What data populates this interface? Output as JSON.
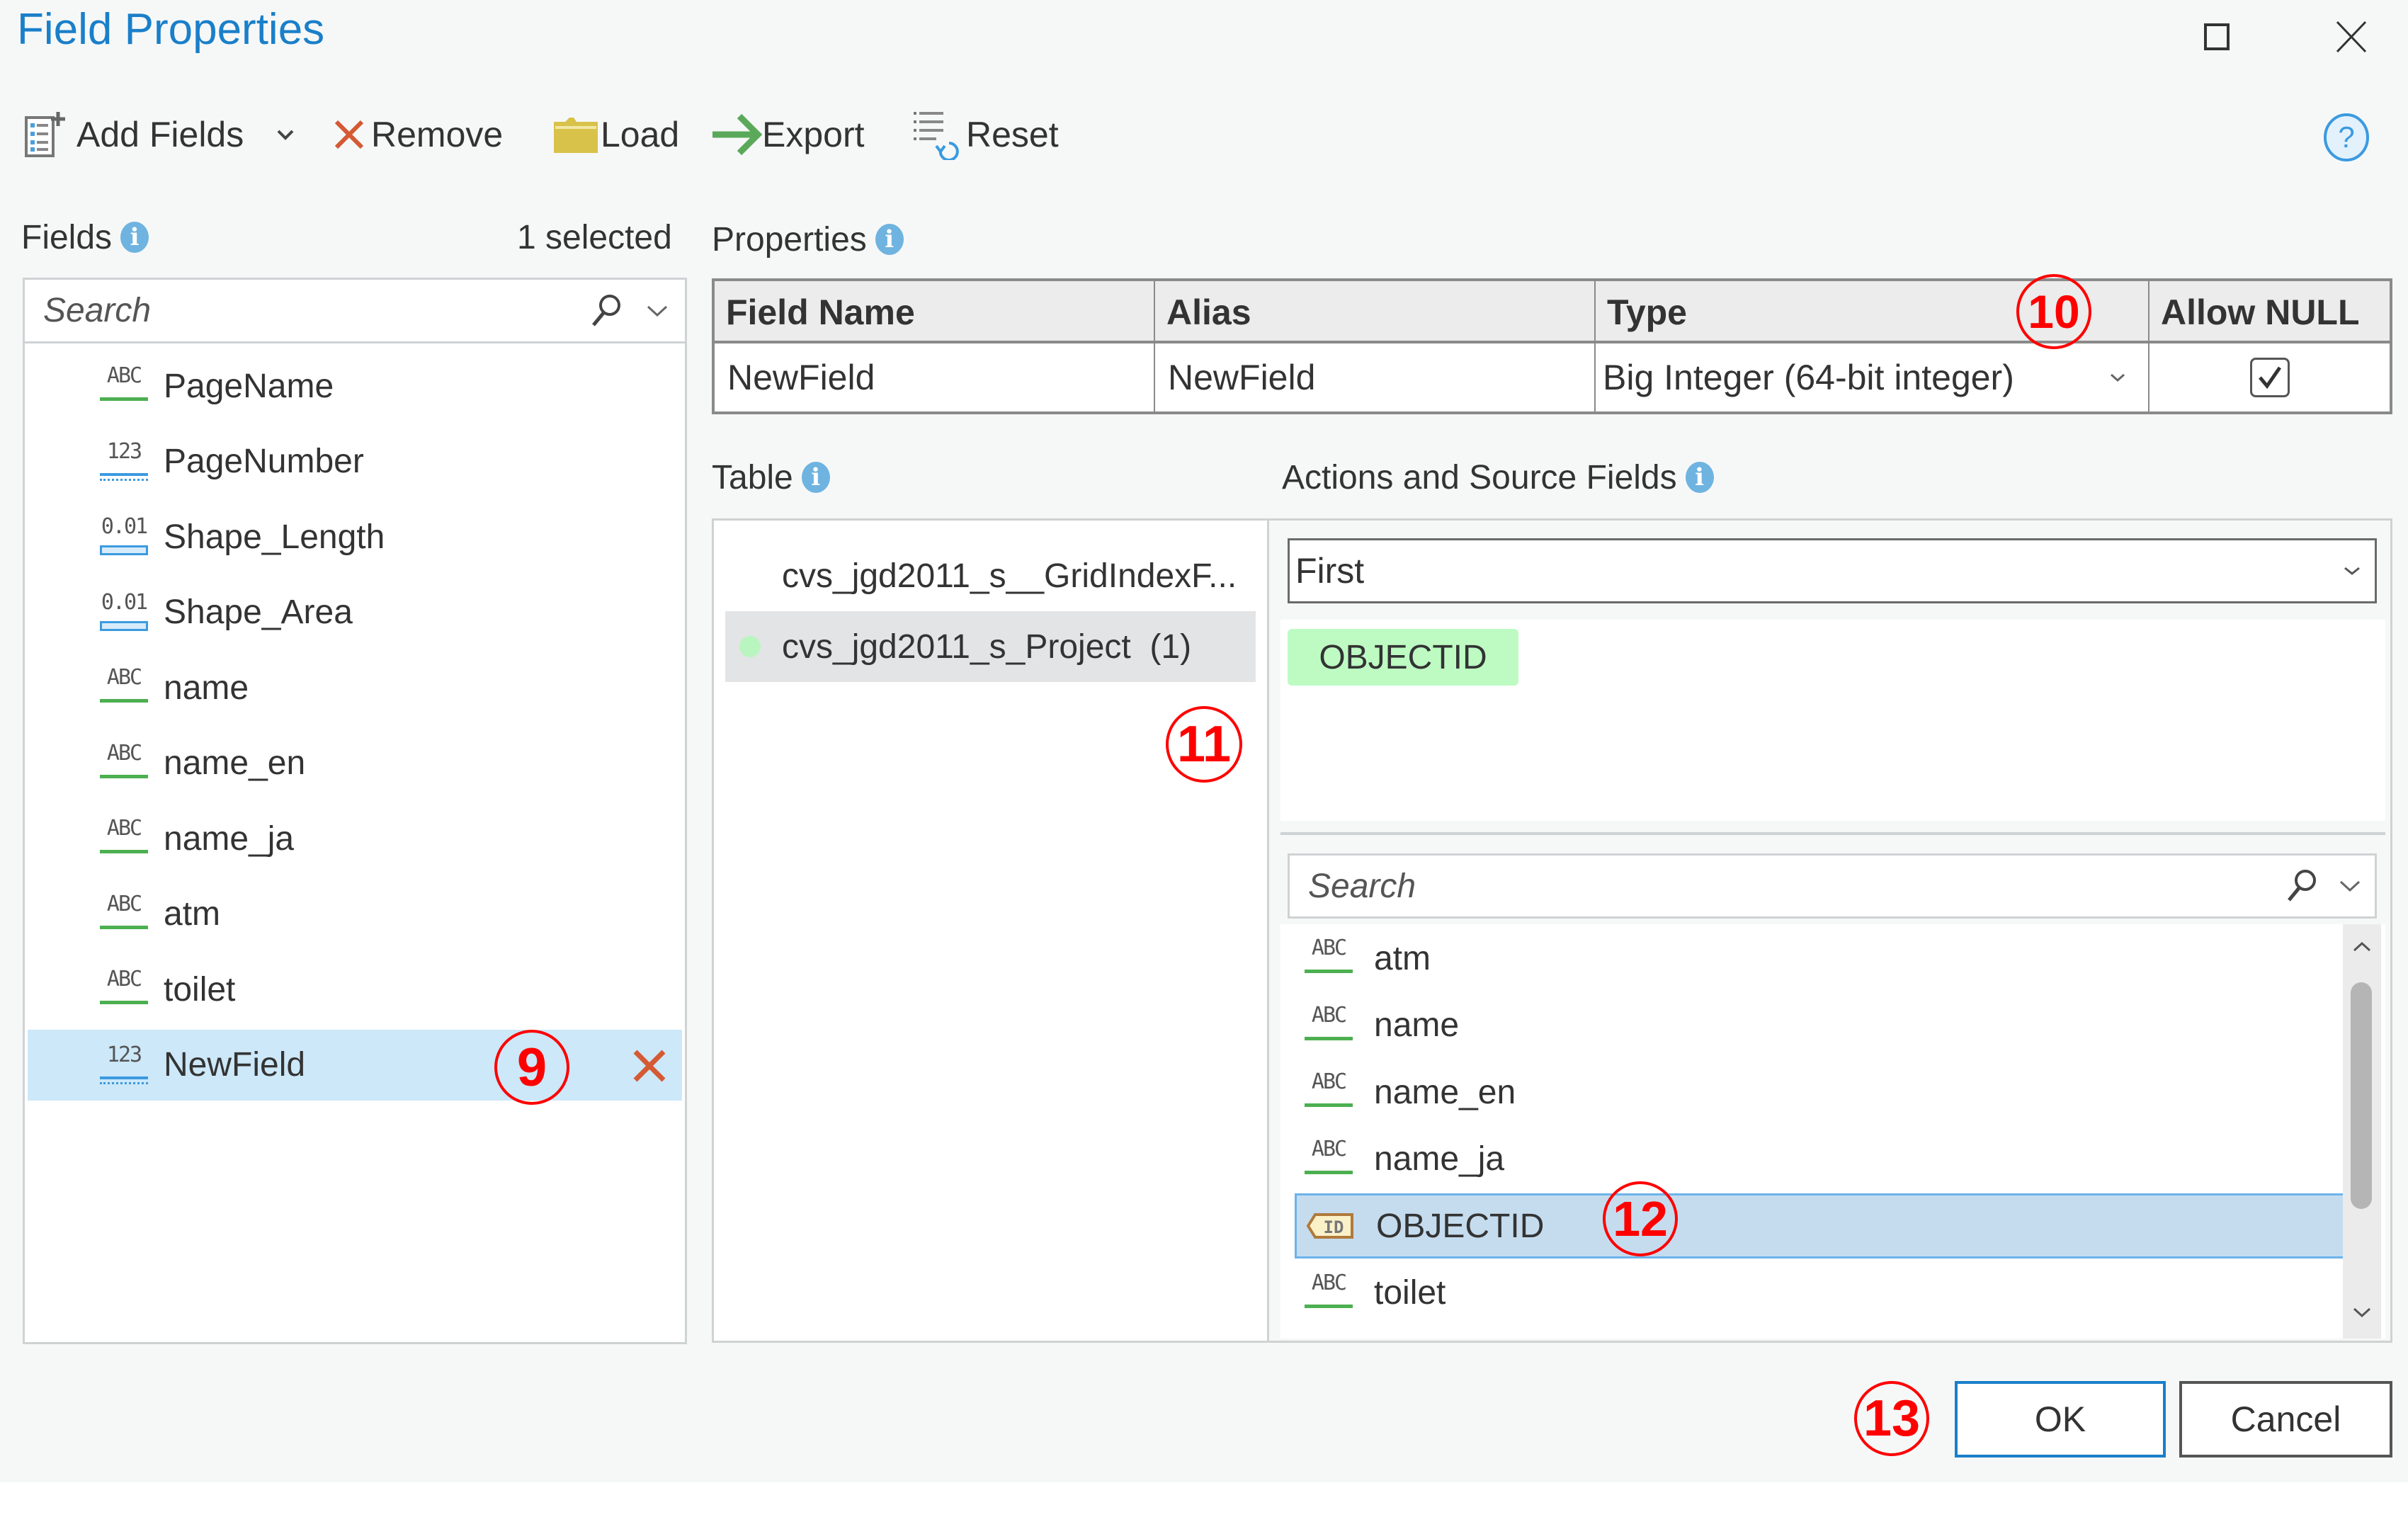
{
  "window": {
    "title": "Field Properties",
    "maximize_icon": "maximize-icon",
    "close_icon": "close-icon"
  },
  "toolbar": {
    "add_fields": "Add Fields",
    "remove": "Remove",
    "load": "Load",
    "export": "Export",
    "reset": "Reset",
    "help_icon": "help-icon"
  },
  "fields_panel": {
    "label": "Fields",
    "selected_count": "1 selected",
    "search_placeholder": "Search",
    "items": [
      {
        "name": "PageName",
        "type_icon": "ABC",
        "type": "text"
      },
      {
        "name": "PageNumber",
        "type_icon": "123",
        "type": "integer"
      },
      {
        "name": "Shape_Length",
        "type_icon": "0.01",
        "type": "double"
      },
      {
        "name": "Shape_Area",
        "type_icon": "0.01",
        "type": "double"
      },
      {
        "name": "name",
        "type_icon": "ABC",
        "type": "text"
      },
      {
        "name": "name_en",
        "type_icon": "ABC",
        "type": "text"
      },
      {
        "name": "name_ja",
        "type_icon": "ABC",
        "type": "text"
      },
      {
        "name": "atm",
        "type_icon": "ABC",
        "type": "text"
      },
      {
        "name": "toilet",
        "type_icon": "ABC",
        "type": "text"
      },
      {
        "name": "NewField",
        "type_icon": "123",
        "type": "big-integer",
        "selected": true
      }
    ]
  },
  "properties": {
    "label": "Properties",
    "columns": [
      "Field Name",
      "Alias",
      "Type",
      "Allow NULL"
    ],
    "row": {
      "field_name": "NewField",
      "alias": "NewField",
      "type": "Big Integer (64-bit integer)",
      "allow_null": true
    }
  },
  "table_panel": {
    "label": "Table",
    "items": [
      {
        "name": "cvs_jgd2011_s__GridIndexF...",
        "selected": false
      },
      {
        "name": "cvs_jgd2011_s_Project  (1)",
        "selected": true,
        "status_color": "#b9f5bf"
      }
    ]
  },
  "actions_panel": {
    "label": "Actions and Source Fields",
    "action_selected": "First",
    "source_chips": [
      "OBJECTID"
    ],
    "search_placeholder": "Search",
    "source_fields": [
      {
        "name": "atm",
        "type_icon": "ABC"
      },
      {
        "name": "name",
        "type_icon": "ABC"
      },
      {
        "name": "name_en",
        "type_icon": "ABC"
      },
      {
        "name": "name_ja",
        "type_icon": "ABC"
      },
      {
        "name": "OBJECTID",
        "type_icon": "ID",
        "selected": true
      },
      {
        "name": "toilet",
        "type_icon": "ABC"
      }
    ]
  },
  "buttons": {
    "ok": "OK",
    "cancel": "Cancel"
  },
  "annotations": [
    "⑨",
    "⑩",
    "⑪",
    "⑫",
    "⑬"
  ],
  "annotation_labels": {
    "a9": "9",
    "a10": "10",
    "a11": "11",
    "a12": "12",
    "a13": "13"
  },
  "colors": {
    "title": "#1a7fc9",
    "selection": "#cce8f9",
    "source_selection": "#c5dcef",
    "chip": "#bdfbc3",
    "remove_x": "#d45a34",
    "annotation": "#ff0000"
  }
}
